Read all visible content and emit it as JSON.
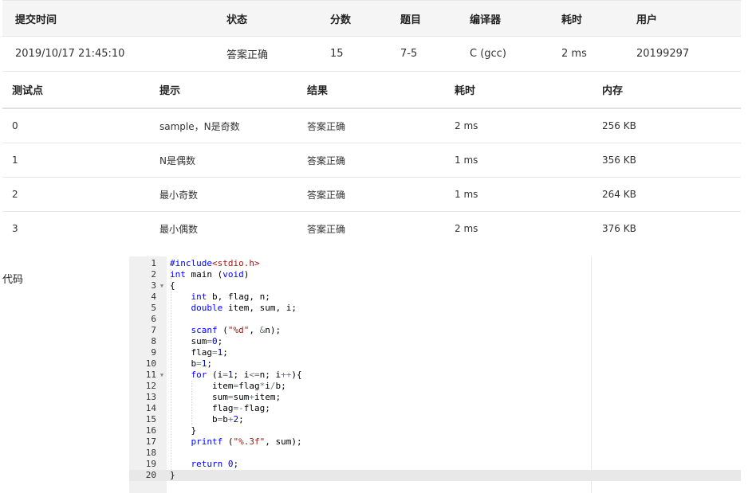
{
  "submission": {
    "headers": [
      "提交时间",
      "状态",
      "分数",
      "题目",
      "编译器",
      "耗时",
      "用户"
    ],
    "time": "2019/10/17 21:45:10",
    "status": "答案正确",
    "score": "15",
    "problem": "7-5",
    "compiler": "C (gcc)",
    "elapsed": "2 ms",
    "user": "20199297"
  },
  "testcases": {
    "headers": [
      "测试点",
      "提示",
      "结果",
      "耗时",
      "内存"
    ],
    "rows": [
      {
        "id": "0",
        "hint": "sample，N是奇数",
        "result": "答案正确",
        "time": "2 ms",
        "memory": "256 KB"
      },
      {
        "id": "1",
        "hint": "N是偶数",
        "result": "答案正确",
        "time": "1 ms",
        "memory": "356 KB"
      },
      {
        "id": "2",
        "hint": "最小奇数",
        "result": "答案正确",
        "time": "1 ms",
        "memory": "264 KB"
      },
      {
        "id": "3",
        "hint": "最小偶数",
        "result": "答案正确",
        "time": "2 ms",
        "memory": "376 KB"
      }
    ]
  },
  "code": {
    "label": "代码",
    "lines": [
      "#include<stdio.h>",
      "int main (void)",
      "{",
      "    int b, flag, n;",
      "    double item, sum, i;",
      "",
      "    scanf (\"%d\", &n);",
      "    sum=0;",
      "    flag=1;",
      "    b=1;",
      "    for (i=1; i<=n; i++){",
      "        item=flag*i/b;",
      "        sum=sum+item;",
      "        flag=-flag;",
      "        b=b+2;",
      "    }",
      "    printf (\"%.3f\", sum);",
      "",
      "    return 0;",
      "}"
    ],
    "fold_lines": [
      3,
      11
    ],
    "active_line": 20
  },
  "colors": {
    "status_ok": "#e74c3c",
    "problem_link": "#1f5fa6",
    "keyword": "#0000ff",
    "string": "#a31515"
  }
}
